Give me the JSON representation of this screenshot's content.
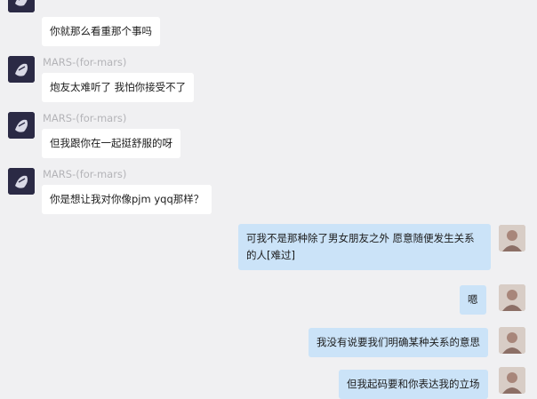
{
  "chat": {
    "messages": [
      {
        "direction": "in",
        "sender": "",
        "text": "你就那么看重那个事吗"
      },
      {
        "direction": "in",
        "sender": "MARS-(for-mars)",
        "text": "炮友太难听了 我怕你接受不了"
      },
      {
        "direction": "in",
        "sender": "MARS-(for-mars)",
        "text": "但我跟你在一起挺舒服的呀"
      },
      {
        "direction": "in",
        "sender": "MARS-(for-mars)",
        "text": "你是想让我对你像pjm yqq那样？"
      },
      {
        "direction": "out",
        "sender": "",
        "line1": "可我不是那种除了男女朋友之外 愿意随便发生关系",
        "line2": "的人[难过]"
      },
      {
        "direction": "out",
        "sender": "",
        "text": "嗯"
      },
      {
        "direction": "out",
        "sender": "",
        "text": "我没有说要我们明确某种关系的意思"
      },
      {
        "direction": "out",
        "sender": "",
        "text": "但我起码要和你表达我的立场"
      }
    ]
  },
  "colors": {
    "background": "#f0f0f2",
    "incoming_bubble": "#ffffff",
    "outgoing_bubble": "#cbe3f8",
    "sender_name": "#b4b4b8"
  }
}
